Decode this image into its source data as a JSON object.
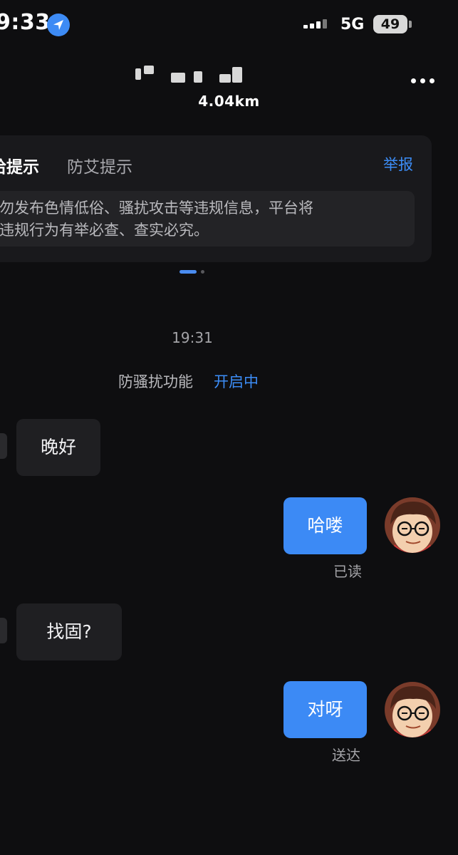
{
  "status_bar": {
    "time": "9:33",
    "network": "5G",
    "battery": "49"
  },
  "header": {
    "distance": "4.04km"
  },
  "notice": {
    "tab_active": "哈提示",
    "tab_inactive": "防艾提示",
    "report": "举报",
    "line1": "请勿发布色情低俗、骚扰攻击等违规信息，平台将",
    "line2": "对违规行为有举必查、查实必究。"
  },
  "chat": {
    "timestamp": "19:31",
    "anti_harass_label": "防骚扰功能",
    "anti_harass_status": "开启中",
    "messages": [
      {
        "side": "in",
        "text": "晚好"
      },
      {
        "side": "out",
        "text": "哈喽",
        "receipt": "已读"
      },
      {
        "side": "in",
        "text": "找固?"
      },
      {
        "side": "out",
        "text": "对呀",
        "receipt": "送达"
      }
    ]
  },
  "colors": {
    "background": "#0e0e10",
    "accent": "#3c8af5",
    "card": "#19191c",
    "incoming_bubble": "#1f1f22"
  },
  "icons": [
    "location-arrow-icon",
    "signal-icon",
    "battery-icon",
    "more-icon",
    "avatar-icon"
  ]
}
